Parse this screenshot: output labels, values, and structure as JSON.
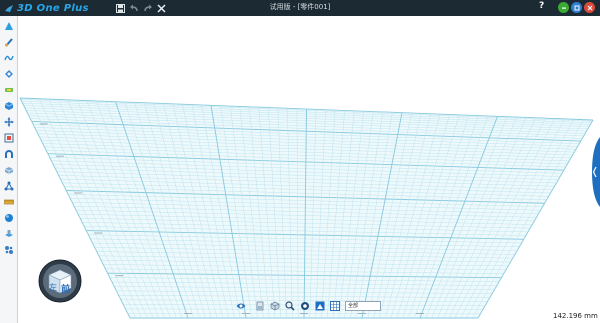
{
  "app": {
    "brand": "3D One Plus",
    "title": "试用版 - [零件001]"
  },
  "window_controls": {
    "help_label": "?"
  },
  "quick_access": [
    "save-icon",
    "undo-icon",
    "redo-icon",
    "close-doc-icon"
  ],
  "left_toolbar": [
    "basic-shape-icon",
    "sketch-icon",
    "curve-icon",
    "edit-sketch-icon",
    "feature-icon",
    "special-function-icon",
    "move-icon",
    "combine-icon",
    "magnet-icon",
    "texture-icon",
    "node-icon",
    "measure-icon",
    "sphere-color-icon",
    "assembly-icon",
    "gear-icon"
  ],
  "viewcube": {
    "front_label": "前",
    "side_label": "左"
  },
  "bottom_toolbar": {
    "icons": [
      "view-eye-icon",
      "view-front-icon",
      "view-iso-icon",
      "zoom-icon",
      "fit-view-icon",
      "render-mode-icon",
      "grid-icon"
    ],
    "render_mode": "全部"
  },
  "status": {
    "measurement": "142.196 mm"
  },
  "colors": {
    "titlebar": "#1c2a33",
    "accent": "#29a6e8",
    "grid_line": "#bfe3ee",
    "grid_major": "#86c9de",
    "close_red": "#d94b3a"
  }
}
